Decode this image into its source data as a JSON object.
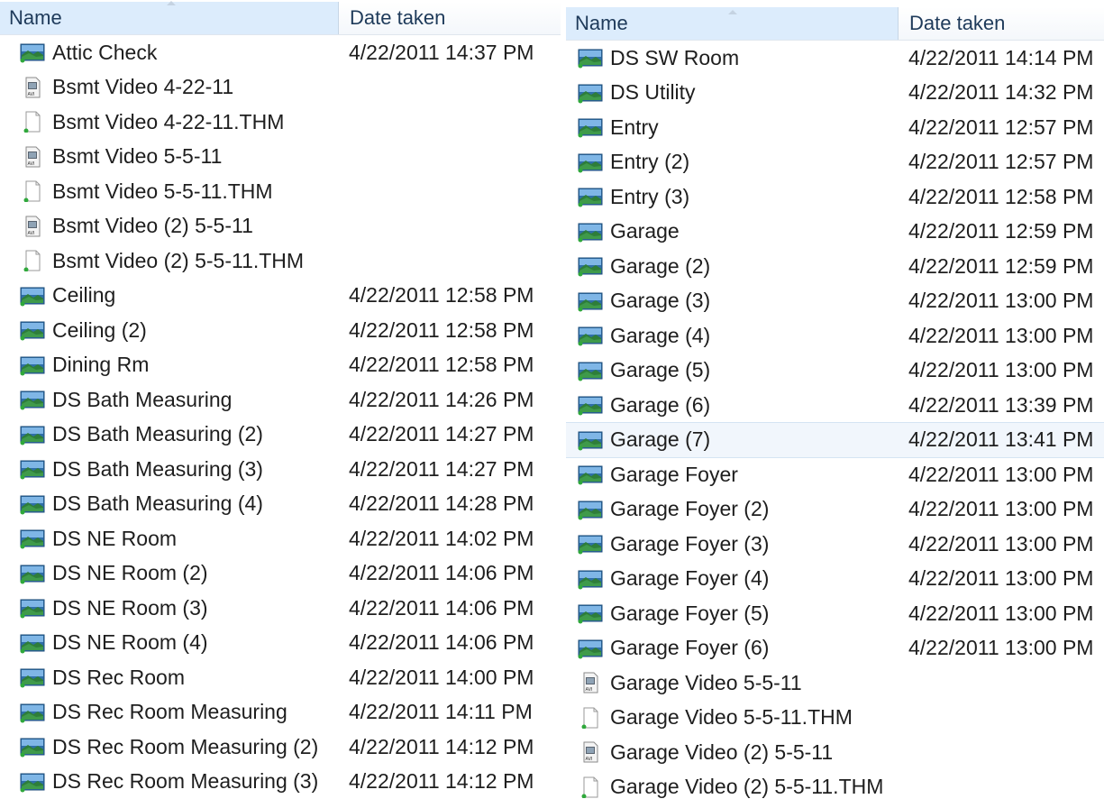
{
  "columns": {
    "name": "Name",
    "date": "Date taken"
  },
  "colors": {
    "header_sorted_bg": "#dcecfc",
    "selected_row_bg": "#f1f6fc",
    "text": "#1e1e1e"
  },
  "left_pane": {
    "rows": [
      {
        "name": "Attic Check",
        "date": "4/22/2011 14:37 PM",
        "icon": "image-file-icon"
      },
      {
        "name": "Bsmt Video 4-22-11",
        "date": "",
        "icon": "avi-video-file-icon"
      },
      {
        "name": "Bsmt Video 4-22-11.THM",
        "date": "",
        "icon": "blank-file-icon"
      },
      {
        "name": "Bsmt Video 5-5-11",
        "date": "",
        "icon": "avi-video-file-icon"
      },
      {
        "name": "Bsmt Video 5-5-11.THM",
        "date": "",
        "icon": "blank-file-icon"
      },
      {
        "name": "Bsmt Video (2) 5-5-11",
        "date": "",
        "icon": "avi-video-file-icon"
      },
      {
        "name": "Bsmt Video (2) 5-5-11.THM",
        "date": "",
        "icon": "blank-file-icon"
      },
      {
        "name": "Ceiling",
        "date": "4/22/2011 12:58 PM",
        "icon": "image-file-icon"
      },
      {
        "name": "Ceiling (2)",
        "date": "4/22/2011 12:58 PM",
        "icon": "image-file-icon"
      },
      {
        "name": "Dining Rm",
        "date": "4/22/2011 12:58 PM",
        "icon": "image-file-icon"
      },
      {
        "name": "DS Bath Measuring",
        "date": "4/22/2011 14:26 PM",
        "icon": "image-file-icon"
      },
      {
        "name": "DS Bath Measuring (2)",
        "date": "4/22/2011 14:27 PM",
        "icon": "image-file-icon"
      },
      {
        "name": "DS Bath Measuring (3)",
        "date": "4/22/2011 14:27 PM",
        "icon": "image-file-icon"
      },
      {
        "name": "DS Bath Measuring (4)",
        "date": "4/22/2011 14:28 PM",
        "icon": "image-file-icon"
      },
      {
        "name": "DS NE Room",
        "date": "4/22/2011 14:02 PM",
        "icon": "image-file-icon"
      },
      {
        "name": "DS NE Room (2)",
        "date": "4/22/2011 14:06 PM",
        "icon": "image-file-icon"
      },
      {
        "name": "DS NE Room (3)",
        "date": "4/22/2011 14:06 PM",
        "icon": "image-file-icon"
      },
      {
        "name": "DS NE Room (4)",
        "date": "4/22/2011 14:06 PM",
        "icon": "image-file-icon"
      },
      {
        "name": "DS Rec Room",
        "date": "4/22/2011 14:00 PM",
        "icon": "image-file-icon"
      },
      {
        "name": "DS Rec Room Measuring",
        "date": "4/22/2011 14:11 PM",
        "icon": "image-file-icon"
      },
      {
        "name": "DS Rec Room Measuring (2)",
        "date": "4/22/2011 14:12 PM",
        "icon": "image-file-icon"
      },
      {
        "name": "DS Rec Room Measuring (3)",
        "date": "4/22/2011 14:12 PM",
        "icon": "image-file-icon"
      }
    ]
  },
  "right_pane": {
    "rows": [
      {
        "name": "DS SW Room",
        "date": "4/22/2011 14:14 PM",
        "icon": "image-file-icon"
      },
      {
        "name": "DS Utility",
        "date": "4/22/2011 14:32 PM",
        "icon": "image-file-icon"
      },
      {
        "name": "Entry",
        "date": "4/22/2011 12:57 PM",
        "icon": "image-file-icon"
      },
      {
        "name": "Entry (2)",
        "date": "4/22/2011 12:57 PM",
        "icon": "image-file-icon"
      },
      {
        "name": "Entry (3)",
        "date": "4/22/2011 12:58 PM",
        "icon": "image-file-icon"
      },
      {
        "name": "Garage",
        "date": "4/22/2011 12:59 PM",
        "icon": "image-file-icon"
      },
      {
        "name": "Garage (2)",
        "date": "4/22/2011 12:59 PM",
        "icon": "image-file-icon"
      },
      {
        "name": "Garage (3)",
        "date": "4/22/2011 13:00 PM",
        "icon": "image-file-icon"
      },
      {
        "name": "Garage (4)",
        "date": "4/22/2011 13:00 PM",
        "icon": "image-file-icon"
      },
      {
        "name": "Garage (5)",
        "date": "4/22/2011 13:00 PM",
        "icon": "image-file-icon"
      },
      {
        "name": "Garage (6)",
        "date": "4/22/2011 13:39 PM",
        "icon": "image-file-icon"
      },
      {
        "name": "Garage (7)",
        "date": "4/22/2011 13:41 PM",
        "icon": "image-file-icon",
        "selected": true
      },
      {
        "name": "Garage Foyer",
        "date": "4/22/2011 13:00 PM",
        "icon": "image-file-icon"
      },
      {
        "name": "Garage Foyer (2)",
        "date": "4/22/2011 13:00 PM",
        "icon": "image-file-icon"
      },
      {
        "name": "Garage Foyer (3)",
        "date": "4/22/2011 13:00 PM",
        "icon": "image-file-icon"
      },
      {
        "name": "Garage Foyer (4)",
        "date": "4/22/2011 13:00 PM",
        "icon": "image-file-icon"
      },
      {
        "name": "Garage Foyer (5)",
        "date": "4/22/2011 13:00 PM",
        "icon": "image-file-icon"
      },
      {
        "name": "Garage Foyer (6)",
        "date": "4/22/2011 13:00 PM",
        "icon": "image-file-icon"
      },
      {
        "name": "Garage Video 5-5-11",
        "date": "",
        "icon": "avi-video-file-icon"
      },
      {
        "name": "Garage Video 5-5-11.THM",
        "date": "",
        "icon": "blank-file-icon"
      },
      {
        "name": "Garage Video (2) 5-5-11",
        "date": "",
        "icon": "avi-video-file-icon"
      },
      {
        "name": "Garage Video (2) 5-5-11.THM",
        "date": "",
        "icon": "blank-file-icon"
      }
    ]
  }
}
